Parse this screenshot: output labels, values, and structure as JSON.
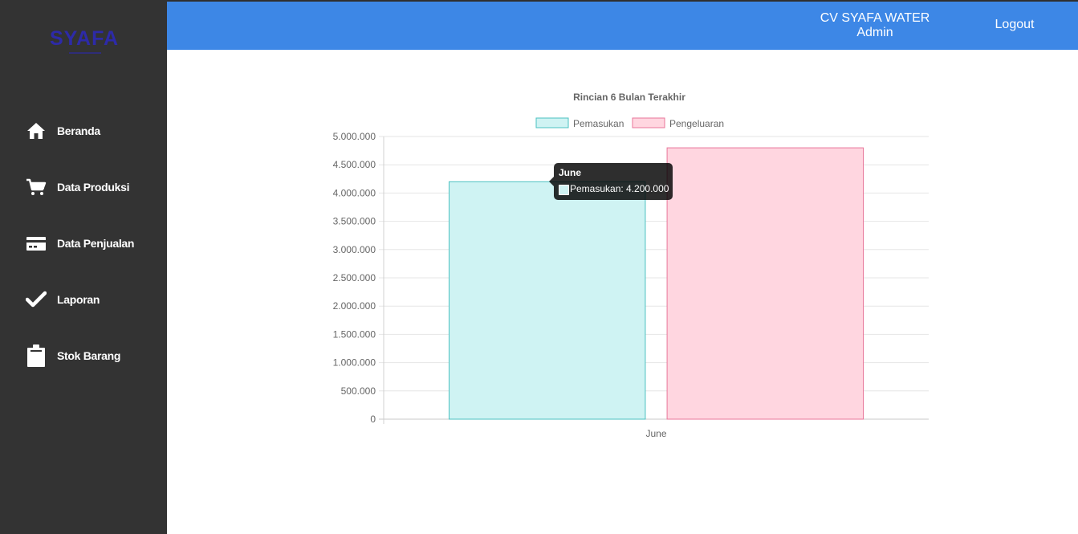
{
  "brand": {
    "logo_text": "SYAFA"
  },
  "sidebar": {
    "items": [
      {
        "label": "Beranda",
        "icon": "home-icon"
      },
      {
        "label": "Data Produksi",
        "icon": "cart-icon"
      },
      {
        "label": "Data Penjualan",
        "icon": "credit-card-icon"
      },
      {
        "label": "Laporan",
        "icon": "check-icon"
      },
      {
        "label": "Stok Barang",
        "icon": "clipboard-icon"
      }
    ]
  },
  "header": {
    "company": "CV SYAFA WATER",
    "role": "Admin",
    "logout_label": "Logout"
  },
  "colors": {
    "sidebar_bg": "#333333",
    "topbar_bg": "#3d87e6",
    "pemasukan_fill": "#cff3f3",
    "pemasukan_border": "#4bc0c0",
    "pengeluaran_fill": "#ffd6e0",
    "pengeluaran_border": "#e8769a"
  },
  "chart_data": {
    "type": "bar",
    "title": "Rincian 6 Bulan Terakhir",
    "categories": [
      "June"
    ],
    "series": [
      {
        "name": "Pemasukan",
        "values": [
          4200000
        ]
      },
      {
        "name": "Pengeluaran",
        "values": [
          4800000
        ]
      }
    ],
    "ylim": [
      0,
      5000000
    ],
    "yticks": [
      "0",
      "500.000",
      "1.000.000",
      "1.500.000",
      "2.000.000",
      "2.500.000",
      "3.000.000",
      "3.500.000",
      "4.000.000",
      "4.500.000",
      "5.000.000"
    ],
    "legend_position": "top",
    "grid": true
  },
  "tooltip": {
    "title": "June",
    "body": "Pemasukan: 4.200.000"
  }
}
